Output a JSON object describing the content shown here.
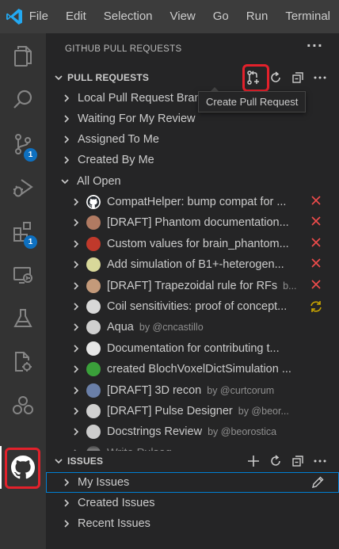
{
  "menubar": {
    "items": [
      "File",
      "Edit",
      "Selection",
      "View",
      "Go",
      "Run",
      "Terminal"
    ]
  },
  "activity": {
    "scm_badge": "1",
    "extensions_badge": "1"
  },
  "sidebar": {
    "title": "GITHUB PULL REQUESTS",
    "pr_section": {
      "label": "PULL REQUESTS",
      "tooltip": "Create Pull Request",
      "categories": [
        "Local Pull Request Branches",
        "Waiting For My Review",
        "Assigned To Me",
        "Created By Me",
        "All Open"
      ],
      "prs": [
        {
          "title": "CompatHelper: bump compat for ...",
          "by": "",
          "status": "x",
          "avatar": "github"
        },
        {
          "title": "[DRAFT] Phantom documentation...",
          "by": "",
          "status": "x",
          "avatar": "a2"
        },
        {
          "title": "Custom values for brain_phantom...",
          "by": "",
          "status": "x",
          "avatar": "a3"
        },
        {
          "title": "Add simulation of B1+-heterogen...",
          "by": "",
          "status": "x",
          "avatar": "a4"
        },
        {
          "title": "[DRAFT] Trapezoidal rule for RFs",
          "by": "b...",
          "status": "x",
          "avatar": "a5"
        },
        {
          "title": "Coil sensitivities: proof of concept...",
          "by": "",
          "status": "sync",
          "avatar": "a6"
        },
        {
          "title": "Aqua",
          "by": "by @cncastillo",
          "status": "",
          "avatar": "a7"
        },
        {
          "title": "Documentation for contributing t...",
          "by": "",
          "status": "",
          "avatar": "a8"
        },
        {
          "title": "created BlochVoxelDictSimulation ...",
          "by": "",
          "status": "",
          "avatar": "a9"
        },
        {
          "title": "[DRAFT] 3D recon",
          "by": "by @curtcorum",
          "status": "",
          "avatar": "a10"
        },
        {
          "title": "[DRAFT] Pulse Designer",
          "by": "by @beor...",
          "status": "",
          "avatar": "a11"
        },
        {
          "title": "Docstrings Review",
          "by": "by @beorostica",
          "status": "",
          "avatar": "a12"
        },
        {
          "title": "Write Pulseq ...",
          "by": "",
          "status": "",
          "avatar": "a13"
        }
      ]
    },
    "issues_section": {
      "label": "ISSUES",
      "items": [
        "My Issues",
        "Created Issues",
        "Recent Issues"
      ]
    }
  },
  "colors": {
    "accent": "#0e70c0",
    "highlight": "#e3212b",
    "close": "#f14c4c",
    "sync": "#cca700"
  }
}
